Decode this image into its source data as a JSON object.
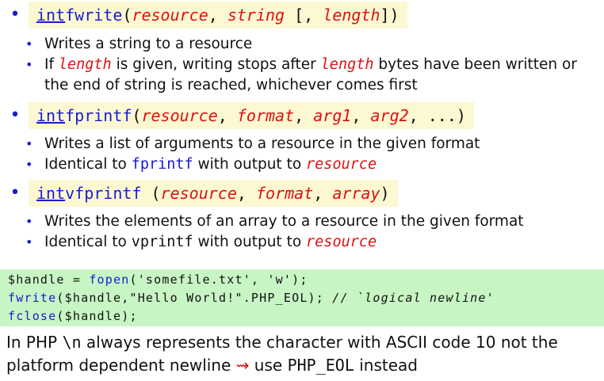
{
  "items": [
    {
      "signature": {
        "return_type": "int",
        "name": "fwrite",
        "open": "(",
        "params_text": [
          "resource",
          ", ",
          "string",
          " [, ",
          "length",
          "])"
        ]
      },
      "bullets": [
        {
          "parts": [
            "Writes a string to a resource"
          ]
        },
        {
          "parts": [
            "If ",
            "length",
            " is given, writing stops after ",
            "length",
            " bytes have been written or the end of string is reached, whichever comes first"
          ]
        }
      ]
    },
    {
      "signature": {
        "return_type": "int",
        "name": "fprintf",
        "open": "(",
        "params_text": [
          "resource",
          ", ",
          "format",
          ", ",
          "arg1",
          ", ",
          "arg2",
          ", ...)"
        ]
      },
      "bullets": [
        {
          "parts": [
            "Writes a list of arguments to a resource in the given format"
          ]
        },
        {
          "parts": [
            "Identical to ",
            "fprintf",
            " with output to ",
            "resource"
          ]
        }
      ]
    },
    {
      "signature": {
        "return_type": "int",
        "name": "vfprintf",
        "open": " (",
        "params_text": [
          "resource",
          ", ",
          "format",
          ", ",
          "array",
          ")"
        ]
      },
      "bullets": [
        {
          "parts": [
            "Writes the elements of an array to a resource in the given format"
          ]
        },
        {
          "parts": [
            "Identical to ",
            "vprintf",
            " with output to ",
            "resource"
          ]
        }
      ]
    }
  ],
  "code": {
    "line1": [
      "$handle = ",
      "fopen",
      "('somefile.txt', 'w');"
    ],
    "line2": [
      "fwrite",
      "($handle,\"Hello World!\".PHP_EOL); ",
      "// `logical newline'"
    ],
    "line3": [
      "fclose",
      "($handle);"
    ]
  },
  "footer": {
    "parts": [
      "In PHP ",
      "\\n",
      " always represents the character with ASCII code 10 not the platform dependent newline ",
      "⇝",
      " use ",
      "PHP_EOL",
      " instead"
    ]
  }
}
